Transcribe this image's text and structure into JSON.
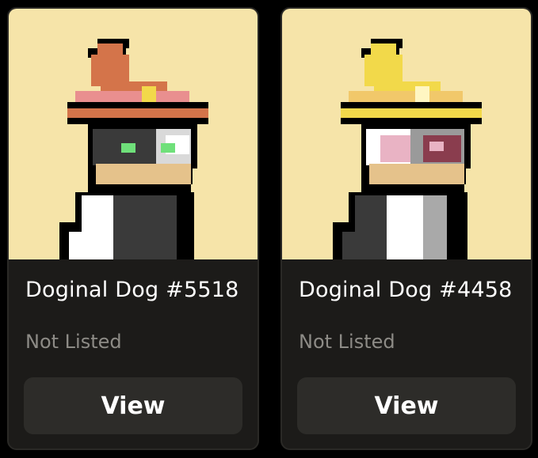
{
  "cards": [
    {
      "title": "Doginal Dog #5518",
      "status": "Not Listed",
      "button_label": "View",
      "hat_color": "#d4744a",
      "hat_band_color": "#e98f8f",
      "eye_color": "#6fe07a"
    },
    {
      "title": "Doginal Dog #4458",
      "status": "Not Listed",
      "button_label": "View",
      "hat_color": "#f2d94a",
      "hat_band_color": "#f1c86a",
      "eye_color": "#e9b3c4"
    }
  ],
  "colors": {
    "page_background": "#000000",
    "card_background": "#1c1b19",
    "art_background": "#f6e4a9",
    "button_background": "#2d2c29",
    "status_text": "#8d8b86"
  }
}
